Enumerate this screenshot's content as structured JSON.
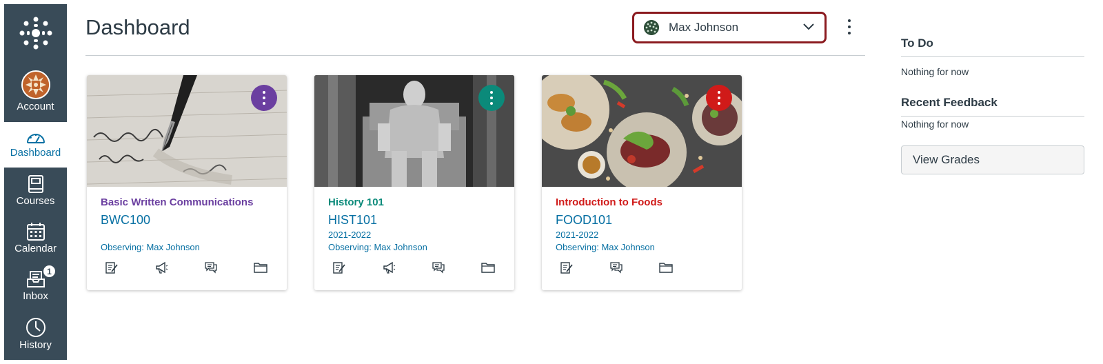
{
  "nav": {
    "account_label": "Account",
    "dashboard_label": "Dashboard",
    "courses_label": "Courses",
    "calendar_label": "Calendar",
    "inbox_label": "Inbox",
    "inbox_badge": "1",
    "history_label": "History"
  },
  "header": {
    "title": "Dashboard",
    "observer_name": "Max Johnson"
  },
  "cards": [
    {
      "name": "Basic Written Communications",
      "code": "BWC100",
      "term": "",
      "observing": "Observing: Max Johnson",
      "color": "#6b3fa0",
      "image": "pen-writing"
    },
    {
      "name": "History 101",
      "code": "HIST101",
      "term": "2021-2022",
      "observing": "Observing: Max Johnson",
      "color": "#0b8a7a",
      "image": "lincoln-statue"
    },
    {
      "name": "Introduction to Foods",
      "code": "FOOD101",
      "term": "2021-2022",
      "observing": "Observing: Max Johnson",
      "color": "#d01a19",
      "image": "food-plates"
    }
  ],
  "sidebar": {
    "todo_title": "To Do",
    "todo_empty": "Nothing for now",
    "feedback_title": "Recent Feedback",
    "feedback_empty": "Nothing for now",
    "view_grades": "View Grades"
  },
  "colors": {
    "nav_bg": "#394b58",
    "link": "#0770a3",
    "observer_border": "#8b1a1f"
  }
}
